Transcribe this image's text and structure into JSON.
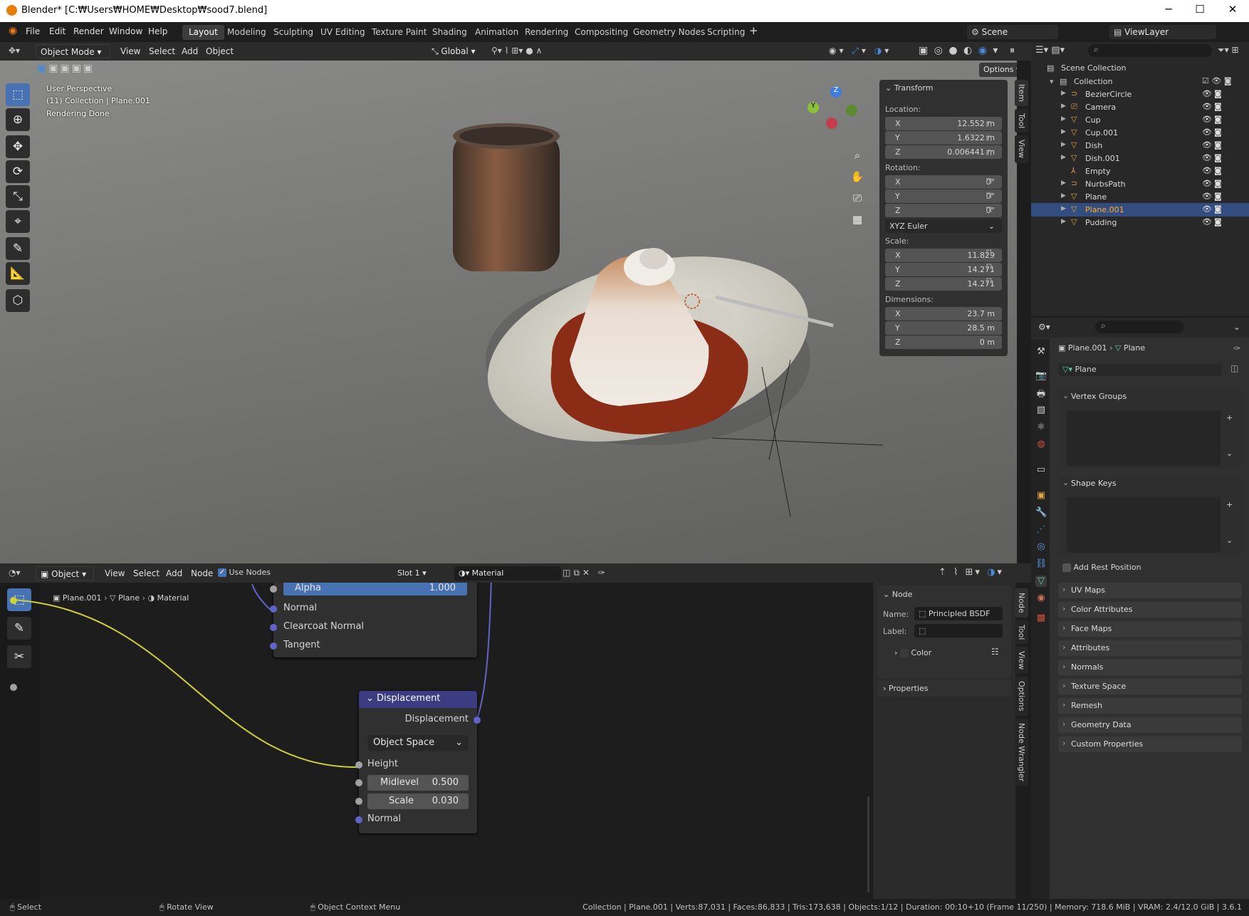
{
  "window": {
    "title": "Blender* [C:₩Users₩HOME₩Desktop₩sood7.blend]"
  },
  "menu": [
    "File",
    "Edit",
    "Render",
    "Window",
    "Help"
  ],
  "workspaces": [
    "Layout",
    "Modeling",
    "Sculpting",
    "UV Editing",
    "Texture Paint",
    "Shading",
    "Animation",
    "Rendering",
    "Compositing",
    "Geometry Nodes",
    "Scripting"
  ],
  "scene": {
    "name": "Scene",
    "view_layer": "ViewLayer"
  },
  "viewport_header": {
    "mode": "Object Mode",
    "menus": [
      "View",
      "Select",
      "Add",
      "Object"
    ],
    "orientation": "Global",
    "options": "Options"
  },
  "viewport_overlay": {
    "line1": "User Perspective",
    "line2": "(11) Collection | Plane.001",
    "line3": "Rendering Done"
  },
  "gizmo": {
    "z": "Z",
    "y": "Y"
  },
  "transform": {
    "title": "Transform",
    "location_label": "Location:",
    "location": [
      {
        "axis": "X",
        "value": "12.552 m"
      },
      {
        "axis": "Y",
        "value": "1.6322 m"
      },
      {
        "axis": "Z",
        "value": "0.006441 m"
      }
    ],
    "rotation_label": "Rotation:",
    "rotation": [
      {
        "axis": "X",
        "value": "0°"
      },
      {
        "axis": "Y",
        "value": "0°"
      },
      {
        "axis": "Z",
        "value": "0°"
      }
    ],
    "rotation_mode": "XYZ Euler",
    "scale_label": "Scale:",
    "scale": [
      {
        "axis": "X",
        "value": "11.829"
      },
      {
        "axis": "Y",
        "value": "14.271"
      },
      {
        "axis": "Z",
        "value": "14.271"
      }
    ],
    "dimensions_label": "Dimensions:",
    "dimensions": [
      {
        "axis": "X",
        "value": "23.7 m"
      },
      {
        "axis": "Y",
        "value": "28.5 m"
      },
      {
        "axis": "Z",
        "value": "0 m"
      }
    ]
  },
  "sidetabs": [
    "Item",
    "Tool",
    "View"
  ],
  "outliner": {
    "scene_collection": "Scene Collection",
    "collection": "Collection",
    "items": [
      "BezierCircle",
      "Camera",
      "Cup",
      "Cup.001",
      "Dish",
      "Dish.001",
      "Empty",
      "NurbsPath",
      "Plane",
      "Plane.001",
      "Pudding"
    ],
    "selected": "Plane.001"
  },
  "properties": {
    "breadcrumb_object": "Plane.001",
    "breadcrumb_data": "Plane",
    "mesh_name": "Plane",
    "vertex_groups": "Vertex Groups",
    "shape_keys": "Shape Keys",
    "add_rest_position": "Add Rest Position",
    "sections": [
      "UV Maps",
      "Color Attributes",
      "Face Maps",
      "Attributes",
      "Normals",
      "Texture Space",
      "Remesh",
      "Geometry Data",
      "Custom Properties"
    ]
  },
  "node_header": {
    "mode": "Object",
    "menus": [
      "View",
      "Select",
      "Add",
      "Node"
    ],
    "use_nodes": "Use Nodes",
    "slot": "Slot 1",
    "material": "Material"
  },
  "node_breadcrumb": {
    "object": "Plane.001",
    "data": "Plane",
    "material": "Material"
  },
  "bsdf_partial": {
    "alpha_label": "Alpha",
    "alpha_value": "1.000",
    "inputs": [
      "Normal",
      "Clearcoat Normal",
      "Tangent"
    ]
  },
  "displacement_node": {
    "title": "Displacement",
    "output": "Displacement",
    "space": "Object Space",
    "height": "Height",
    "midlevel_label": "Midlevel",
    "midlevel_value": "0.500",
    "scale_label": "Scale",
    "scale_value": "0.030",
    "normal": "Normal"
  },
  "node_sidebar": {
    "panel": "Node",
    "name_label": "Name:",
    "name_value": "Principled BSDF",
    "label_label": "Label:",
    "color": "Color",
    "properties": "Properties"
  },
  "node_sidetabs": [
    "Node",
    "Tool",
    "View",
    "Options",
    "Node Wrangler"
  ],
  "status": {
    "select": "Select",
    "rotate": "Rotate View",
    "context": "Object Context Menu",
    "info": "Collection | Plane.001 | Verts:87,031 | Faces:86,833 | Tris:173,638 | Objects:1/12 | Duration: 00:10+10 (Frame 11/250) | Memory: 718.6 MiB | VRAM: 2.4/12.0 GiB | 3.6.1"
  },
  "colors": {
    "accent": "#4772b3",
    "selection": "#334d80",
    "object_orange": "#e8a33f",
    "mesh_green": "#5fc8a4"
  }
}
